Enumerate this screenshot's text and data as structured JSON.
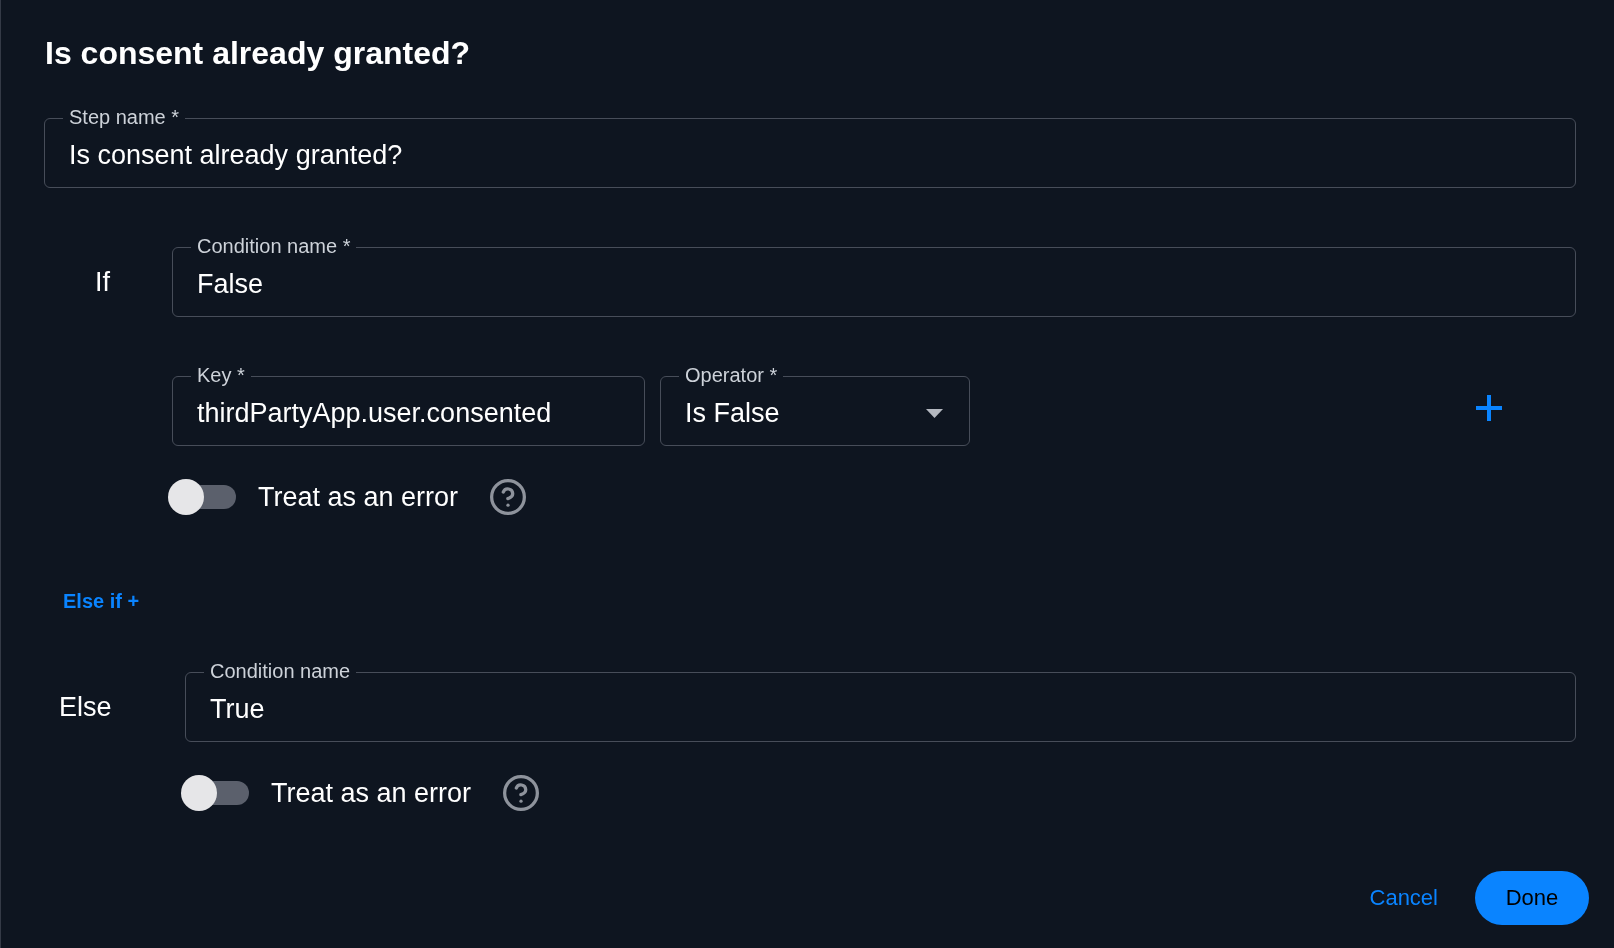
{
  "dialog": {
    "title": "Is consent already granted?"
  },
  "step_name": {
    "label": "Step name *",
    "value": "Is consent already granted?"
  },
  "if_branch": {
    "keyword": "If",
    "condition": {
      "label": "Condition name *",
      "value": "False"
    },
    "rules": [
      {
        "key": {
          "label": "Key *",
          "value": "thirdPartyApp.user.consented"
        },
        "operator": {
          "label": "Operator *",
          "value": "Is False"
        }
      }
    ],
    "treat_as_error": {
      "label": "Treat as an error",
      "on": false
    }
  },
  "else_if_link": {
    "label": "Else if +"
  },
  "else_branch": {
    "keyword": "Else",
    "condition": {
      "label": "Condition name",
      "value": "True"
    },
    "treat_as_error": {
      "label": "Treat as an error",
      "on": false
    }
  },
  "buttons": [
    {
      "label": "Cancel",
      "kind": "text"
    },
    {
      "label": "Done",
      "kind": "primary"
    }
  ]
}
